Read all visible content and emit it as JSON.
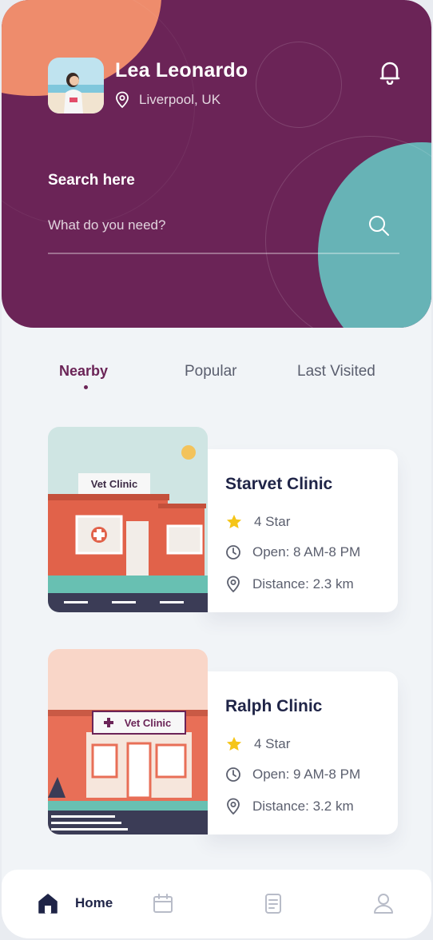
{
  "profile": {
    "name": "Lea Leonardo",
    "location": "Liverpool, UK"
  },
  "search": {
    "heading": "Search here",
    "placeholder": "What do you need?"
  },
  "tabs": [
    {
      "label": "Nearby",
      "active": true
    },
    {
      "label": "Popular",
      "active": false
    },
    {
      "label": "Last Visited",
      "active": false
    }
  ],
  "clinics": [
    {
      "name": "Starvet Clinic",
      "sign": "Vet Clinic",
      "rating": "4 Star",
      "hours": "Open: 8 AM-8 PM",
      "distance": "Distance: 2.3 km"
    },
    {
      "name": "Ralph Clinic",
      "sign": "Vet Clinic",
      "rating": "4 Star",
      "hours": "Open: 9 AM-8 PM",
      "distance": "Distance: 3.2 km"
    }
  ],
  "nav": {
    "home_label": "Home",
    "items": [
      "home-icon",
      "calendar-icon",
      "document-icon",
      "profile-icon"
    ]
  },
  "colors": {
    "primary": "#6b2457",
    "accent_orange": "#ee8c6c",
    "accent_teal": "#67b3b6",
    "star": "#f5c518",
    "title": "#1f2447"
  }
}
